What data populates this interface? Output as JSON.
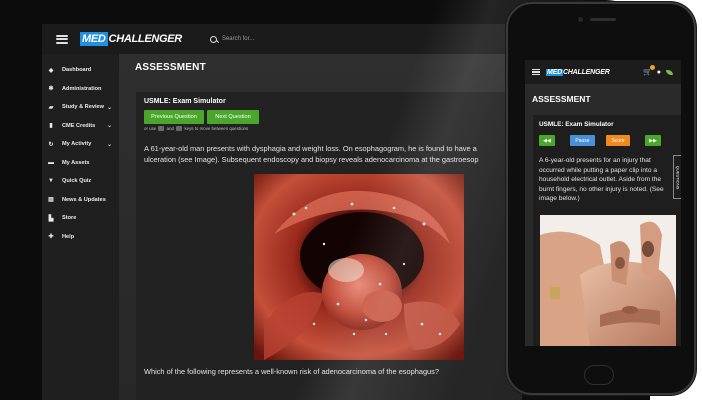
{
  "desktop": {
    "logo": {
      "part1": "MED",
      "part2": "CHALLENGER"
    },
    "search": {
      "placeholder": "Search for..."
    },
    "sidebar": {
      "items": [
        {
          "label": "Dashboard",
          "icon": "dashboard-icon",
          "glyph": "◆",
          "chevron": false
        },
        {
          "label": "Administration",
          "icon": "gear-icon",
          "glyph": "✱",
          "chevron": false
        },
        {
          "label": "Study & Review",
          "icon": "graduation-cap-icon",
          "glyph": "▰",
          "chevron": true
        },
        {
          "label": "CME Credits",
          "icon": "certificate-icon",
          "glyph": "▮",
          "chevron": true
        },
        {
          "label": "My Activity",
          "icon": "history-icon",
          "glyph": "↻",
          "chevron": true
        },
        {
          "label": "My Assets",
          "icon": "folder-icon",
          "glyph": "▬",
          "chevron": false
        },
        {
          "label": "Quick Quiz",
          "icon": "trophy-icon",
          "glyph": "▼",
          "chevron": false
        },
        {
          "label": "News & Updates",
          "icon": "newspaper-icon",
          "glyph": "▤",
          "chevron": false
        },
        {
          "label": "Store",
          "icon": "cart-icon",
          "glyph": "▙",
          "chevron": false
        },
        {
          "label": "Help",
          "icon": "life-ring-icon",
          "glyph": "✚",
          "chevron": false
        }
      ],
      "chevron_glyph": "⌄"
    },
    "main": {
      "title": "ASSESSMENT",
      "simulator_title": "USMLE: Exam Simulator",
      "previous_label": "Previous Question",
      "next_label": "Next Question",
      "hint_prefix": "or use",
      "hint_middle": "and",
      "hint_suffix": "keys to move between questions",
      "stem_line1": "A 61-year-old man presents with dysphagia and weight loss. On esophagogram, he is found to have a",
      "stem_line2": "ulceration (see Image). Subsequent endoscopy and biopsy reveals adenocarcinoma at the gastroesop",
      "question": "Which of the following represents a well-known risk of adenocarcinoma of the esophagus?"
    }
  },
  "phone": {
    "logo": {
      "part1": "MED",
      "part2": "CHALLENGER"
    },
    "title": "ASSESSMENT",
    "simulator_title": "USMLE: Exam Simulator",
    "buttons": {
      "previous_glyph": "◀◀",
      "pause_label": "Pause",
      "score_label": "Score",
      "next_glyph": "▶▶"
    },
    "stem": "A 6-year-old presents for an injury that occurred while putting a paper clip into a household electrical outlet. Aside from the burnt fingers, no other injury is noted. (See image below.)",
    "questions_tab": "QUESTIONS",
    "icons": {
      "cart": "cart-icon",
      "user": "user-icon",
      "leaf": "leaf-icon"
    }
  },
  "colors": {
    "green": "#4aa72c",
    "blue": "#4a90d9",
    "orange": "#f08c1e",
    "brand_blue": "#1f8fe0"
  }
}
